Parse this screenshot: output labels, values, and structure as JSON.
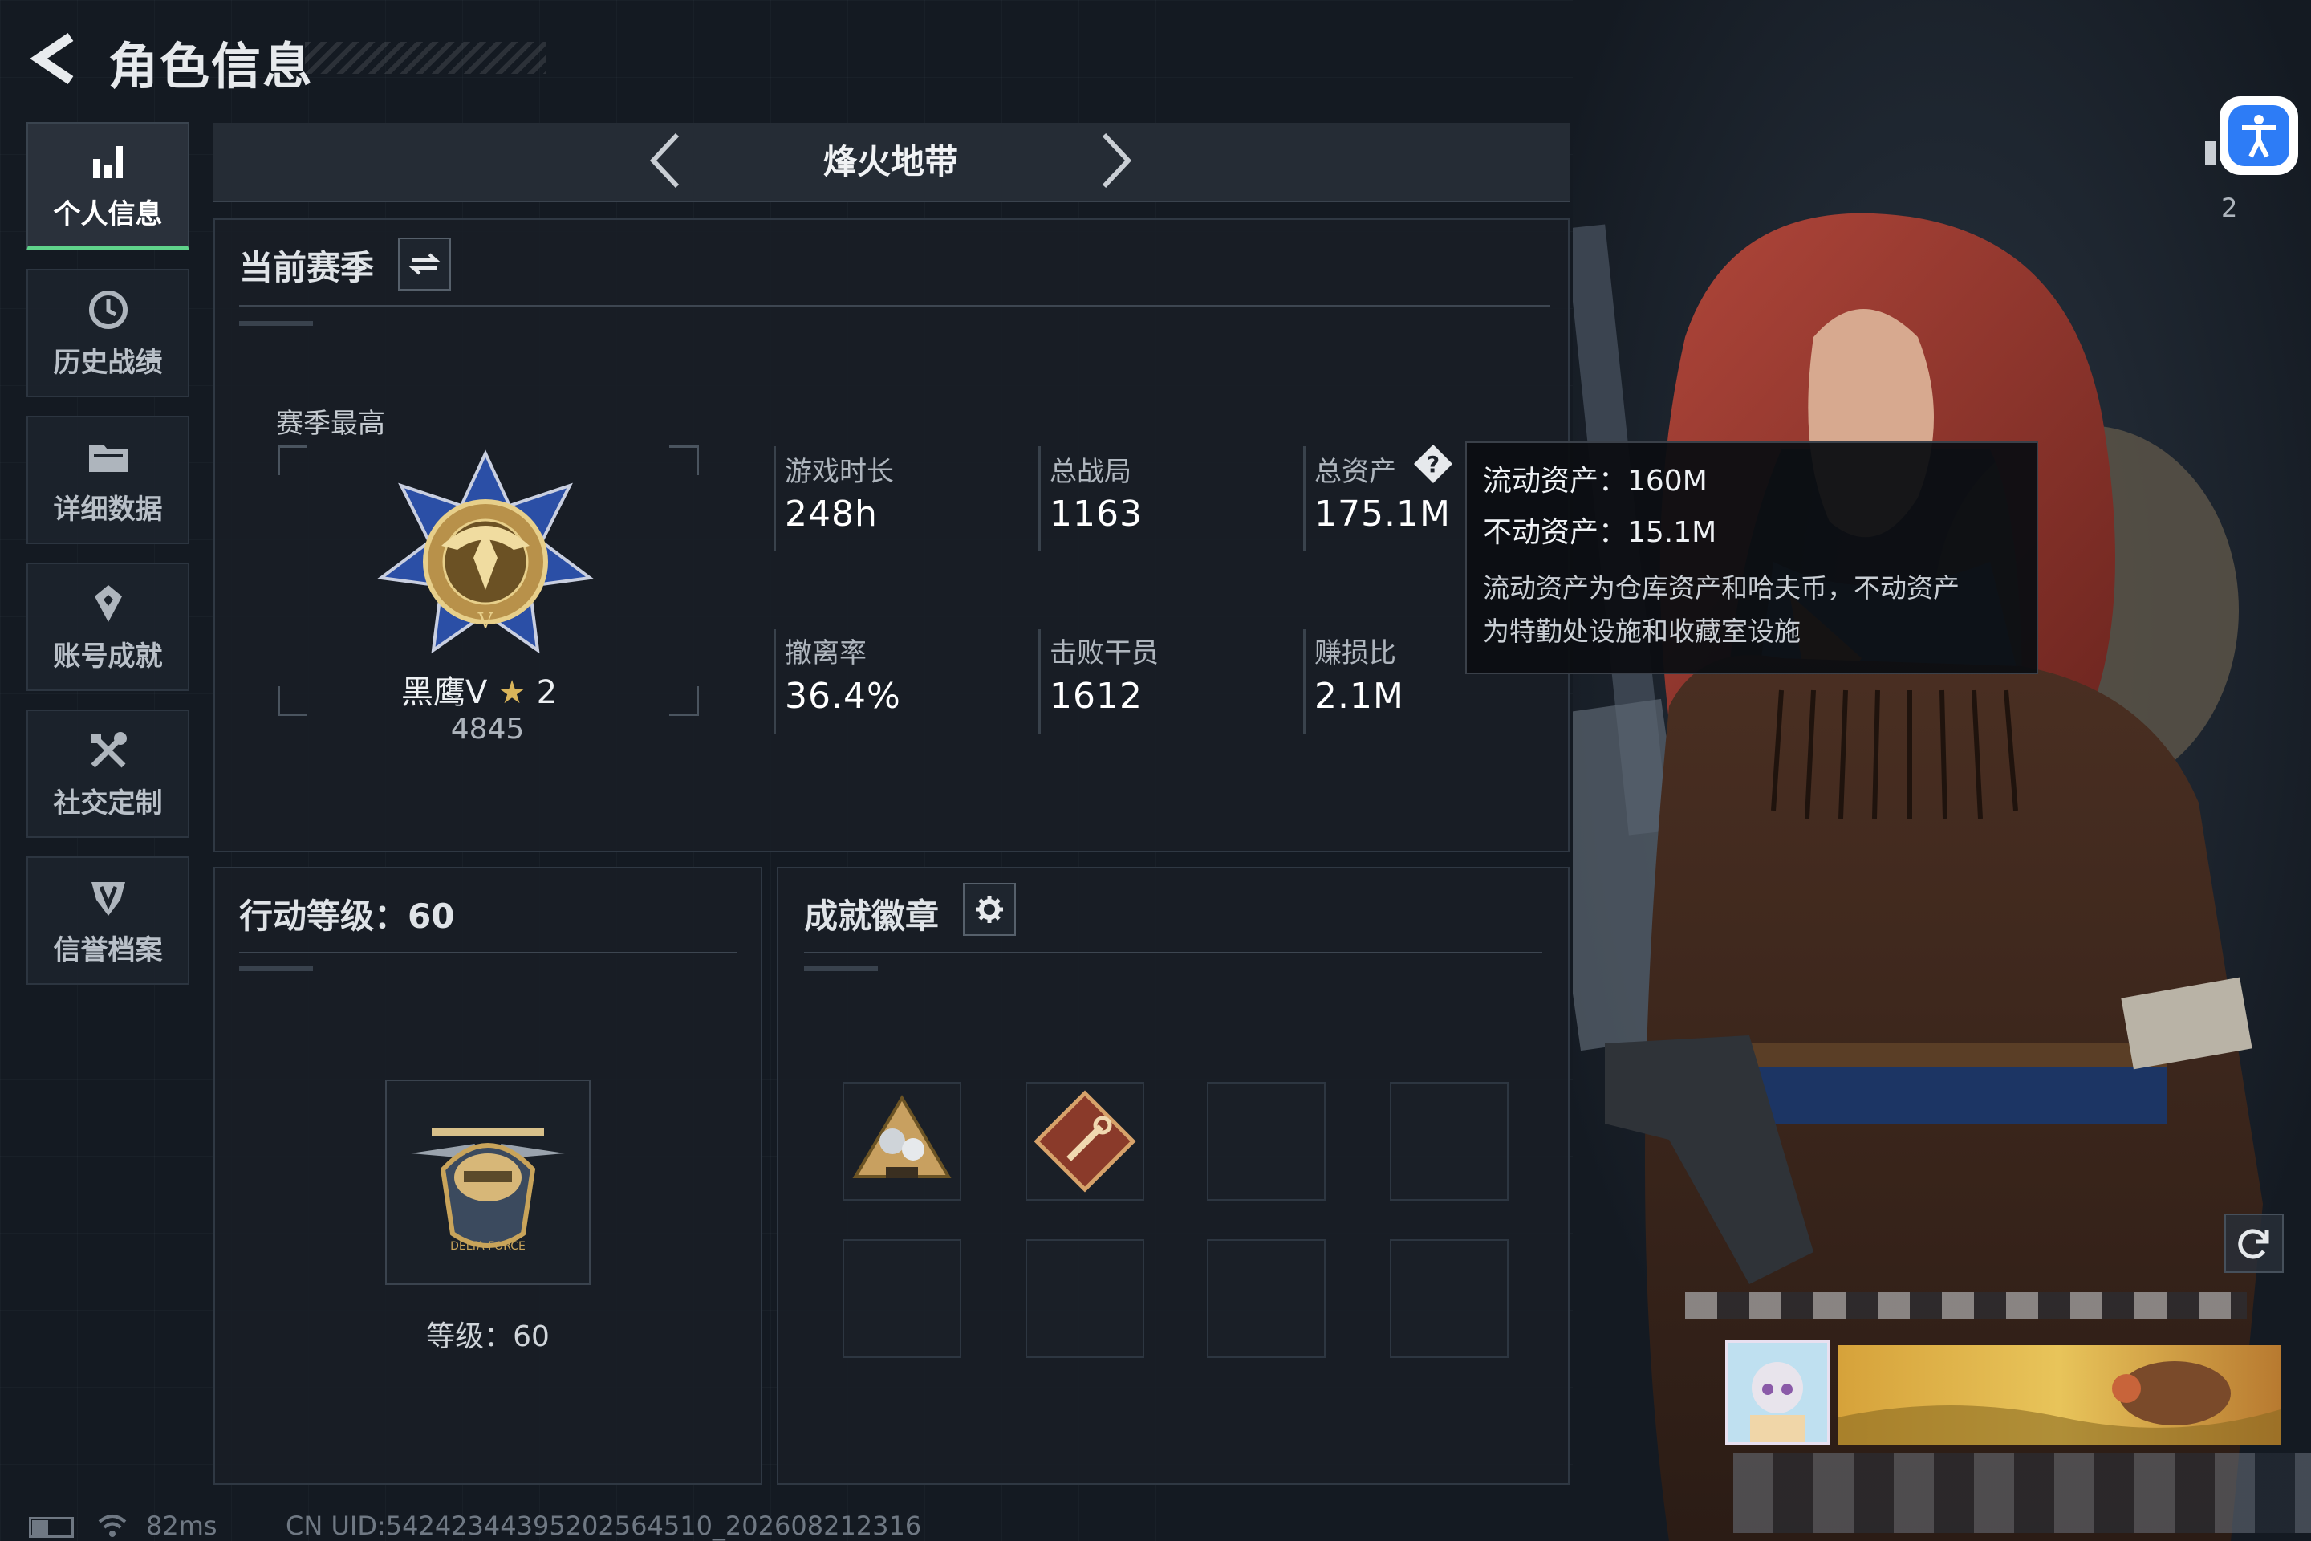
{
  "header": {
    "title": "角色信息"
  },
  "sidebar": {
    "items": [
      {
        "label": "个人信息",
        "icon": "bar-chart-icon",
        "active": true
      },
      {
        "label": "历史战绩",
        "icon": "clock-icon",
        "active": false
      },
      {
        "label": "详细数据",
        "icon": "folder-icon",
        "active": false
      },
      {
        "label": "账号成就",
        "icon": "achievement-icon",
        "active": false
      },
      {
        "label": "社交定制",
        "icon": "tools-icon",
        "active": false
      },
      {
        "label": "信誉档案",
        "icon": "shield-badge-icon",
        "active": false
      }
    ]
  },
  "mode": {
    "title": "烽火地带"
  },
  "season": {
    "title": "当前赛季",
    "best_label": "赛季最高",
    "rank_name": "黑鹰V",
    "rank_stars": "2",
    "rank_score": "4845",
    "stats": [
      {
        "label": "游戏时长",
        "value": "248h"
      },
      {
        "label": "总战局",
        "value": "1163"
      },
      {
        "label": "总资产",
        "value": "175.1M"
      },
      {
        "label": "撤离率",
        "value": "36.4%"
      },
      {
        "label": "击败干员",
        "value": "1612"
      },
      {
        "label": "赚损比",
        "value": "2.1M"
      }
    ]
  },
  "tooltip": {
    "liquid": "流动资产：160M",
    "fixed": "不动资产：15.1M",
    "note_line1": "流动资产为仓库资产和哈夫币，不动资产",
    "note_line2": "为特勤处设施和收藏室设施"
  },
  "action_level": {
    "title": "行动等级：60",
    "level_text": "等级：60"
  },
  "badges": {
    "title": "成就徽章"
  },
  "right_hud": {
    "count": "2"
  },
  "status_bar": {
    "ping": "82ms",
    "uid": "CN UID:5424234439520256451​0_202608212316"
  },
  "colors": {
    "accent_green": "#5fd38a",
    "accessibility_blue": "#2d7cf6",
    "background": "#141a22"
  }
}
